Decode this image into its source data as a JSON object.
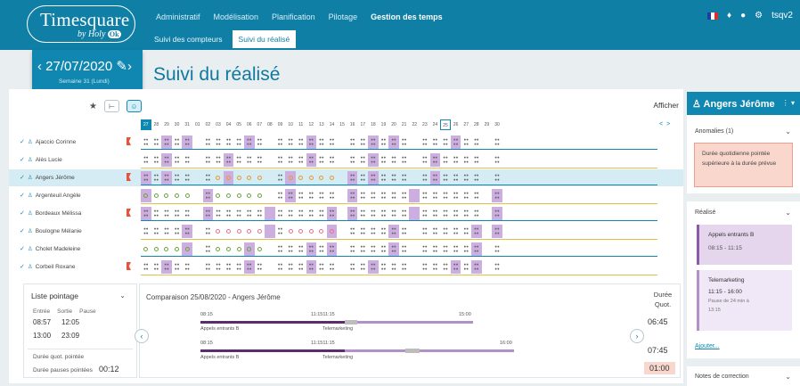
{
  "brand": {
    "line1": "Timesquare",
    "line2": "by Holy",
    "badge": "Ok"
  },
  "menu": [
    "Administratif",
    "Modélisation",
    "Planification",
    "Pilotage",
    "Gestion des temps"
  ],
  "submenu": [
    "Suivi des compteurs",
    "Suivi du réalisé"
  ],
  "user": "tsqv2",
  "date": {
    "value": "27/07/2020",
    "week": "Semaine 31 (Lundi)"
  },
  "page_title": "Suivi du réalisé",
  "afficher": "Afficher",
  "days": [
    "27",
    "28",
    "29",
    "30",
    "31",
    "01",
    "02",
    "03",
    "04",
    "05",
    "06",
    "07",
    "08",
    "09",
    "10",
    "11",
    "12",
    "13",
    "14",
    "15",
    "16",
    "17",
    "18",
    "19",
    "20",
    "21",
    "22",
    "23",
    "24",
    "25",
    "26",
    "27",
    "28",
    "29",
    "30"
  ],
  "employees": [
    {
      "name": "Ajaccio Corinne",
      "flag": true
    },
    {
      "name": "Alès Lucie",
      "flag": false
    },
    {
      "name": "Angers Jérôme",
      "flag": true,
      "selected": true
    },
    {
      "name": "Argenteuil Angèle",
      "flag": false
    },
    {
      "name": "Bordeaux Mélissa",
      "flag": true
    },
    {
      "name": "Boulogne Mélanie",
      "flag": false
    },
    {
      "name": "Cholet Madeleine",
      "flag": false
    },
    {
      "name": "Corbeil Roxane",
      "flag": true
    }
  ],
  "liste": {
    "title": "Liste pointage",
    "cols": [
      "Entrée",
      "Sortie",
      "Pause"
    ],
    "rows": [
      [
        "08:57",
        "12:05"
      ],
      [
        "13:00",
        "23:09"
      ]
    ],
    "duree_quot": "Durée quot. pointée",
    "duree_pauses": "Durée pauses pointées",
    "duree_pauses_val": "00:12"
  },
  "comparison": {
    "title": "Comparaison 25/08/2020 - Angers Jérôme",
    "row1": {
      "start": "08:15",
      "mid": "11:1511:15",
      "end": "15:00",
      "act1": "Appels entrants B",
      "act2": "Telemarketing"
    },
    "row2": {
      "start": "08:15",
      "mid": "11:1511:15",
      "end": "16:00",
      "act1": "Appels entrants B",
      "act2": "Telemarketing"
    },
    "duree_label": "Durée Quot.",
    "v1": "06:45",
    "v2": "07:45",
    "v3": "01:00"
  },
  "right": {
    "name": "Angers Jérôme",
    "anomalies": "Anomalies (1)",
    "anom_text": "Durée quotidienne pointée supérieure à la durée prévue",
    "realise": "Réalisé",
    "act1": {
      "title": "Appels entrants B",
      "time": "08:15 - 11:15"
    },
    "act2": {
      "title": "Telemarketing",
      "time": "11:15 - 16:00",
      "pause": "Pause de 24 min à",
      "pause_time": "13:15"
    },
    "ajouter": "Ajouter...",
    "notes": "Notes de correction"
  },
  "colors": {
    "primary": "#0f7fa6",
    "rest_day": "#ccaee0",
    "anomaly": "#fad7cd"
  }
}
